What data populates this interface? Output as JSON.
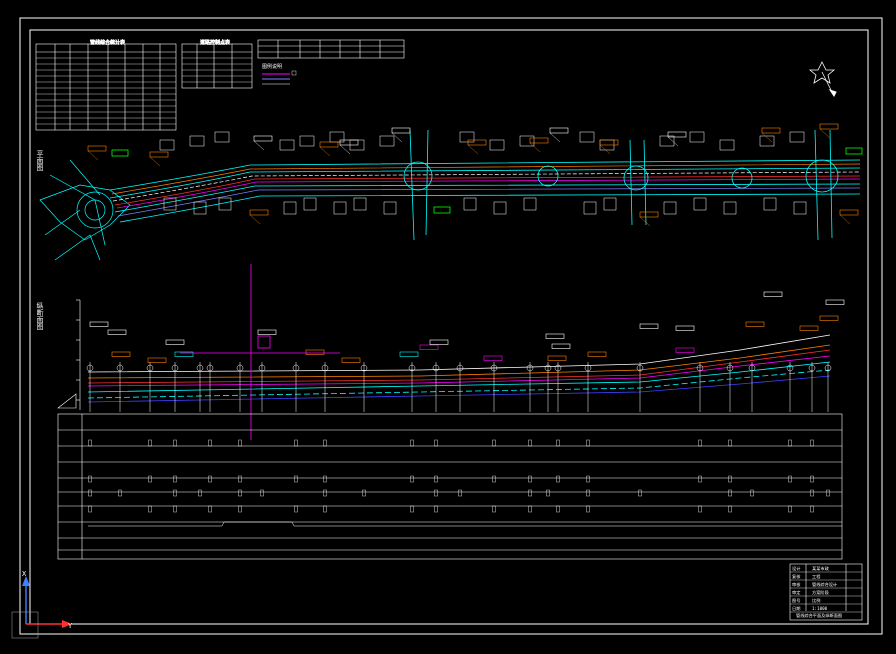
{
  "viewport": {
    "background": "#000000",
    "axis_labels": {
      "x": "Y",
      "y": "X"
    }
  },
  "sheet": {
    "section_plan_label": "平面图",
    "section_profile_label": "纵断面图"
  },
  "legend_title": "图例说明",
  "tables": {
    "table1_title": "管线综合统计表",
    "table2_title": "道路控制点表"
  },
  "title_block": {
    "rows": [
      "设计",
      "复核",
      "审核",
      "审定",
      "图号",
      "日期"
    ],
    "right_cells": [
      "某某市政",
      "工程",
      "管线综合设计",
      "方案阶段",
      "比例",
      "1:1000"
    ],
    "footer": "管线综合平面及纵断面图"
  },
  "colors": {
    "frame": "#ffffff",
    "cyan": "#00ffff",
    "magenta": "#ff00ff",
    "orange": "#ff8000",
    "green": "#00ff00",
    "red": "#ff3030",
    "blue": "#4040ff",
    "yellow": "#ffff00"
  }
}
